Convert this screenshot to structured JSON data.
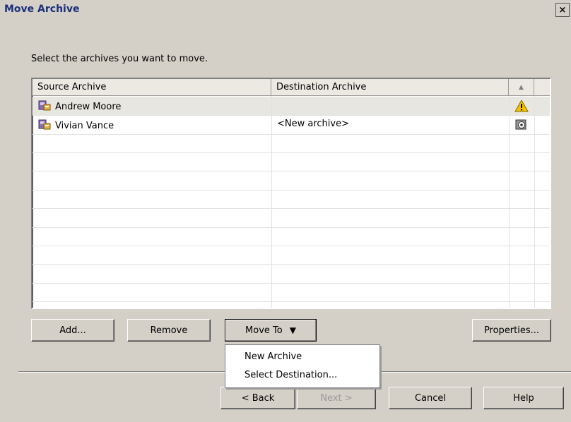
{
  "window": {
    "title": "Move Archive",
    "close_glyph": "×"
  },
  "instruction": "Select the archives you want to move.",
  "grid": {
    "headers": {
      "source": "Source Archive",
      "destination": "Destination Archive",
      "sort_glyph": "▲"
    },
    "rows": [
      {
        "source": "Andrew Moore",
        "destination": "",
        "status_icon": "warning-icon"
      },
      {
        "source": "Vivian Vance",
        "destination": "<New archive>",
        "status_icon": "archive-gear-icon"
      }
    ]
  },
  "buttons": {
    "add": "Add...",
    "remove": "Remove",
    "move_to": "Move To",
    "move_to_arrow": "▼",
    "properties": "Properties...",
    "back": "< Back",
    "next": "Next >",
    "cancel": "Cancel",
    "help": "Help"
  },
  "menu": {
    "items": [
      "New Archive",
      "Select Destination..."
    ]
  },
  "colors": {
    "dialog_bg": "#d4d0c8",
    "title_text": "#1a2f7a",
    "warning": "#f2c200"
  }
}
